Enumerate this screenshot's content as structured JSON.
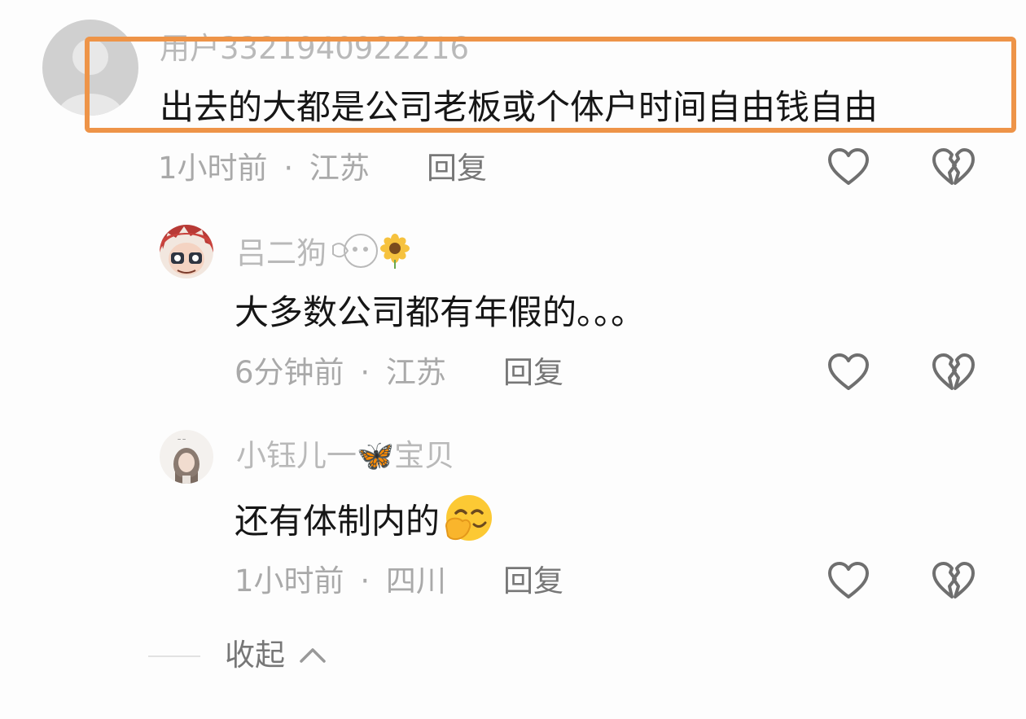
{
  "comments": [
    {
      "username": "用户3321940922216",
      "text": "出去的大都是公司老板或个体户时间自由钱自由",
      "time": "1小时前",
      "separator": "·",
      "location": "江苏",
      "reply_label": "回复"
    },
    {
      "username": "吕二狗",
      "text": "大多数公司都有年假的。。。",
      "time": "6分钟前",
      "separator": "·",
      "location": "江苏",
      "reply_label": "回复"
    },
    {
      "username": "小钰儿一🦋宝贝",
      "text": "还有体制内的",
      "time": "1小时前",
      "separator": "·",
      "location": "四川",
      "reply_label": "回复"
    }
  ],
  "collapse_label": "收起",
  "icons": {
    "like": "heart-outline-icon",
    "dislike": "broken-heart-icon",
    "collapse": "chevron-up-icon"
  },
  "colors": {
    "highlight": "#ee9448",
    "username": "#b9b9b9",
    "text": "#161616",
    "meta": "#a9a9a9"
  }
}
